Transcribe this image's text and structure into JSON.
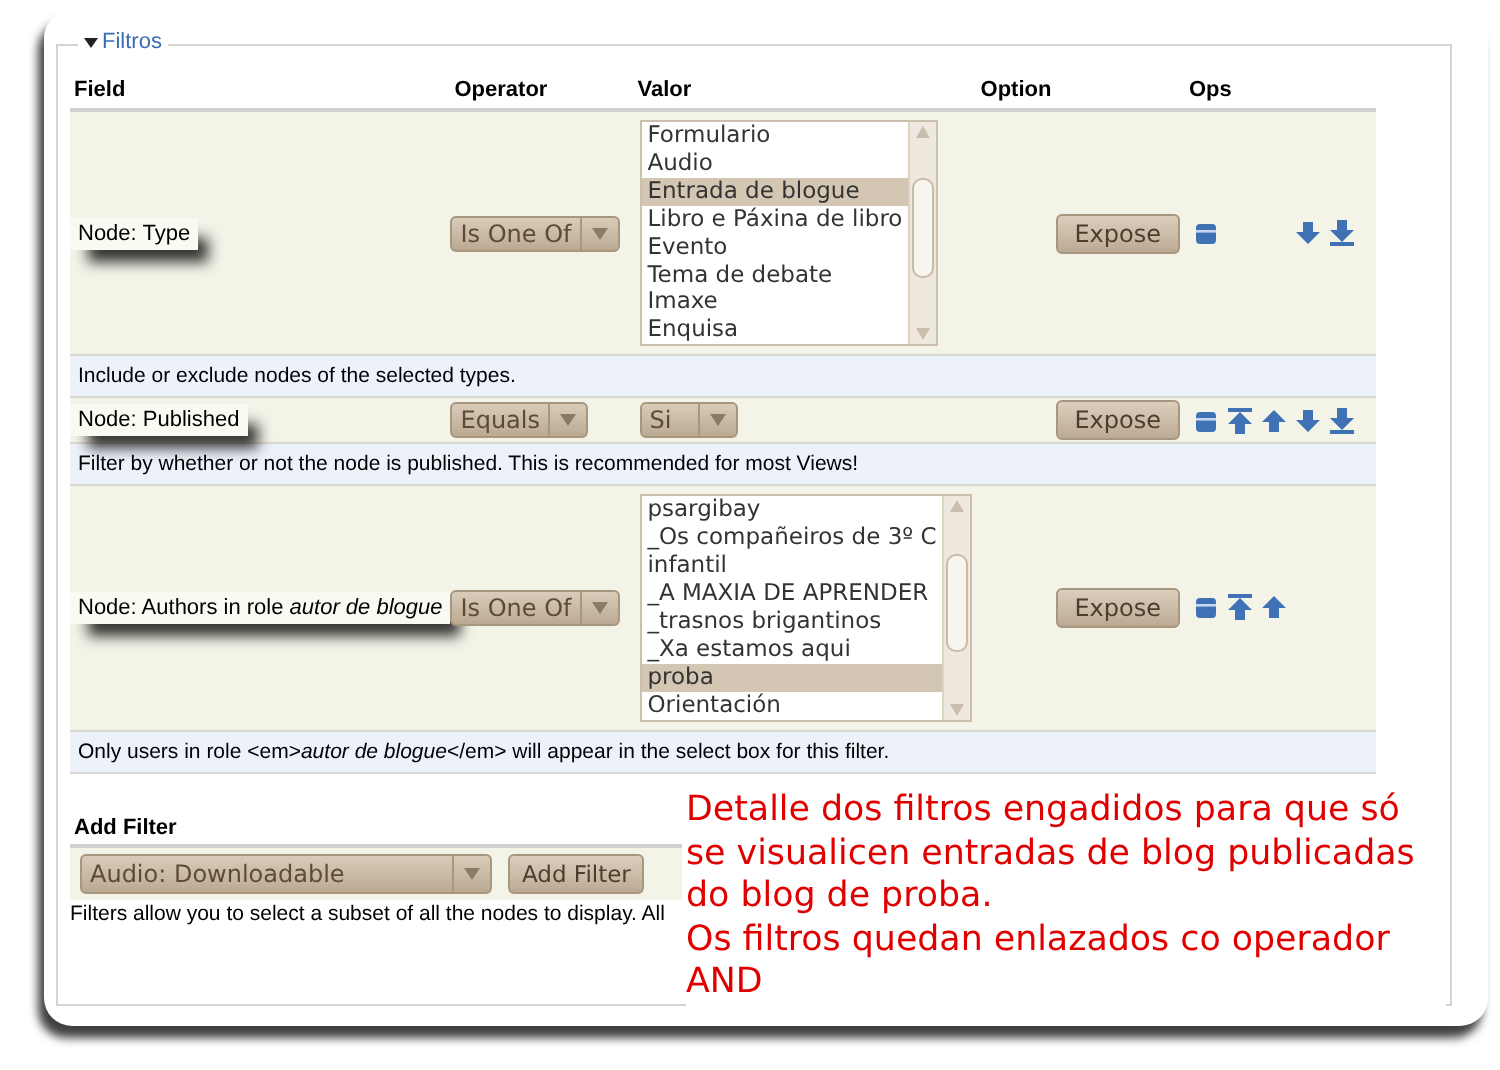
{
  "section": {
    "legend": "Filtros",
    "expanded": true
  },
  "table": {
    "columns": [
      "Field",
      "Operator",
      "Valor",
      "Option",
      "Ops"
    ],
    "filters": [
      {
        "field": "Node: Type",
        "operator": "Is One Of",
        "value": {
          "kind": "listbox",
          "options": [
            {
              "label": "Formulario",
              "selected": false
            },
            {
              "label": "Audio",
              "selected": false
            },
            {
              "label": "Entrada de blogue",
              "selected": true
            },
            {
              "label": "Libro e Páxina de libro",
              "selected": false
            },
            {
              "label": "Evento",
              "selected": false
            },
            {
              "label": "Tema de debate",
              "selected": false
            },
            {
              "label": "Imaxe",
              "selected": false
            },
            {
              "label": "Enquisa",
              "selected": false
            }
          ]
        },
        "expose": "Expose",
        "ops": {
          "remove": true,
          "top": false,
          "up": false,
          "down": true,
          "bottom": true
        },
        "description": "Include or exclude nodes of the selected types."
      },
      {
        "field": "Node: Published",
        "operator": "Equals",
        "value": {
          "kind": "select",
          "text": "Si"
        },
        "expose": "Expose",
        "ops": {
          "remove": true,
          "top": true,
          "up": true,
          "down": true,
          "bottom": true
        },
        "description": "Filter by whether or not the node is published. This is recommended for most Views!"
      },
      {
        "field": "Node: Authors in role *autor de blogue*",
        "operator": "Is One Of",
        "value": {
          "kind": "listbox",
          "options": [
            {
              "label": "psargibay",
              "selected": false
            },
            {
              "label": "_Os compañeiros de 3º C",
              "selected": false
            },
            {
              "label": "infantil",
              "selected": false
            },
            {
              "label": "_A MAXIA DE APRENDER",
              "selected": false
            },
            {
              "label": "_trasnos brigantinos",
              "selected": false
            },
            {
              "label": "_Xa estamos aqui",
              "selected": false
            },
            {
              "label": "proba",
              "selected": true
            },
            {
              "label": "Orientación",
              "selected": false
            }
          ]
        },
        "expose": "Expose",
        "ops": {
          "remove": true,
          "top": true,
          "up": true,
          "down": false,
          "bottom": false
        },
        "description": "Only users in role <em>*autor de blogue*</em> will appear in the select box for this filter."
      }
    ]
  },
  "add_filter": {
    "label": "Add Filter",
    "select": "Audio: Downloadable",
    "button": "Add Filter"
  },
  "footer": "Filters allow you to select a subset of all the nodes to display. All",
  "annotation": [
    "Detalle dos filtros engadidos para que só se visualicen entradas de blog publicadas do blog de proba.",
    "Os filtros quedan enlazados co operador AND"
  ]
}
